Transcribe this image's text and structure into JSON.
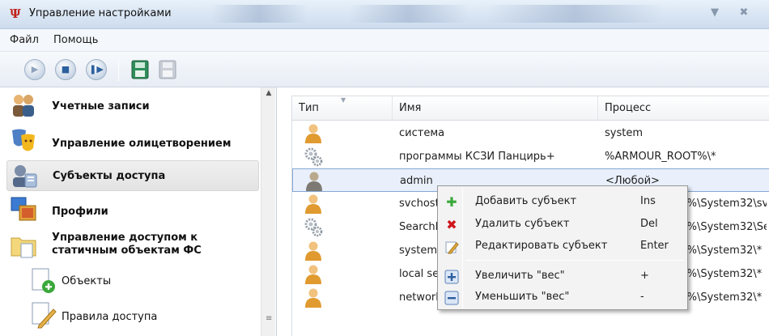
{
  "window": {
    "title": "Управление настройками"
  },
  "menu": {
    "file": "Файл",
    "help": "Помощь"
  },
  "toolbar": {
    "buttons": [
      {
        "icon": "play-icon",
        "state": "disabled"
      },
      {
        "icon": "stop-icon",
        "state": "active"
      },
      {
        "icon": "pause-icon",
        "state": "active"
      },
      {
        "icon": "save-green-icon",
        "state": "active"
      },
      {
        "icon": "save-gray-icon",
        "state": "disabled"
      }
    ]
  },
  "sidebar": {
    "items": [
      {
        "label": "Учетные записи",
        "icon": "users-icon"
      },
      {
        "label": "Управление олицетворением",
        "icon": "masks-icon"
      },
      {
        "label": "Субъекты доступа",
        "icon": "subjects-icon",
        "selected": true
      },
      {
        "label": "Профили",
        "icon": "profiles-icon"
      },
      {
        "label_line1": "Управление доступом к",
        "label_line2": "статичным объектам ФС",
        "icon": "folder-icon"
      }
    ],
    "subitems": [
      {
        "label": "Объекты",
        "icon": "add-document-icon"
      },
      {
        "label": "Правила доступа",
        "icon": "edit-document-icon"
      }
    ]
  },
  "grid": {
    "columns": [
      "Тип",
      "Имя",
      "Процесс"
    ],
    "rows": [
      {
        "type": "user",
        "name": "система",
        "process": "system"
      },
      {
        "type": "gear",
        "name": "программы КСЗИ Панцирь+",
        "process": "%ARMOUR_ROOT%\\*"
      },
      {
        "type": "user-gray",
        "name": "admin",
        "process": "<Любой>",
        "selected": true
      },
      {
        "type": "user",
        "name": "svchost",
        "process": "%SYSTEMROOT%\\System32\\sv"
      },
      {
        "type": "gear",
        "name": "SearchF",
        "process": "%SYSTEMROOT%\\System32\\Se"
      },
      {
        "type": "user",
        "name": "system",
        "process": "%SYSTEMROOT%\\System32\\*"
      },
      {
        "type": "user",
        "name": "local se",
        "process": "%SYSTEMROOT%\\System32\\*"
      },
      {
        "type": "user",
        "name": "network service - system32",
        "process": "%SYSTEMROOT%\\System32\\*"
      }
    ]
  },
  "context_menu": {
    "items": [
      {
        "label": "Добавить субъект",
        "shortcut": "Ins",
        "icon": "add-plus-icon"
      },
      {
        "label": "Удалить субъект",
        "shortcut": "Del",
        "icon": "delete-x-icon"
      },
      {
        "label": "Редактировать субъект",
        "shortcut": "Enter",
        "icon": "edit-pencil-icon"
      },
      {
        "label": "Увеличить \"вес\"",
        "shortcut": "+",
        "icon": "increase-icon"
      },
      {
        "label": "Уменьшить \"вес\"",
        "shortcut": "-",
        "icon": "decrease-icon"
      }
    ]
  },
  "colors": {
    "accent": "#2c5f9e",
    "selection_border": "#86a7d4",
    "selection_fill": "#e9f0fb",
    "delete_red": "#d0141a",
    "add_green": "#3aa83a"
  }
}
